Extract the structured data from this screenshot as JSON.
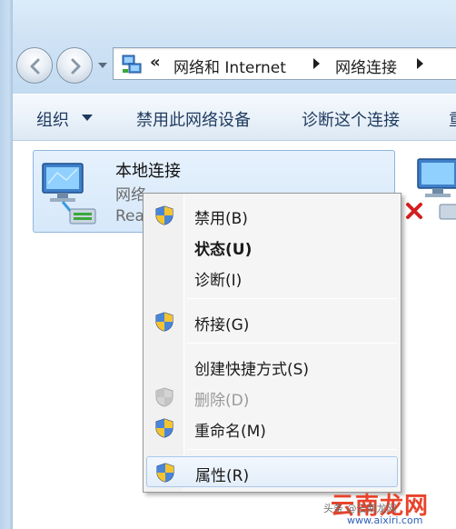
{
  "address_bar": {
    "overflow_chevron": "«",
    "crumbs": [
      "网络和 Internet",
      "网络连接"
    ]
  },
  "command_bar": {
    "organize": "组织",
    "disable_device": "禁用此网络设备",
    "diagnose_connection": "诊断这个连接",
    "truncated_next": "重"
  },
  "connection": {
    "name": "本地连接",
    "type": "网络",
    "status": "Rea"
  },
  "context_menu": {
    "items": [
      {
        "label": "禁用(B)",
        "icon": "uac-shield-icon",
        "style": "normal"
      },
      {
        "label": "状态(U)",
        "icon": "",
        "style": "bold"
      },
      {
        "label": "诊断(I)",
        "icon": "",
        "style": "normal"
      },
      {
        "label": "桥接(G)",
        "icon": "uac-shield-icon",
        "style": "normal"
      },
      {
        "label": "创建快捷方式(S)",
        "icon": "",
        "style": "normal"
      },
      {
        "label": "删除(D)",
        "icon": "uac-shield-icon",
        "style": "disabled"
      },
      {
        "label": "重命名(M)",
        "icon": "uac-shield-icon",
        "style": "normal"
      },
      {
        "label": "属性(R)",
        "icon": "uac-shield-icon",
        "style": "hover"
      }
    ]
  },
  "watermark": {
    "top_text": "头条 @云南龙网",
    "brand": "云南龙网",
    "url": "www.aixiri.com"
  },
  "colors": {
    "glass": "#cfe3f5",
    "menu_bg": "#f5f5f5",
    "hover_border": "#a8c8ea",
    "brand_red": "#e8432b"
  }
}
